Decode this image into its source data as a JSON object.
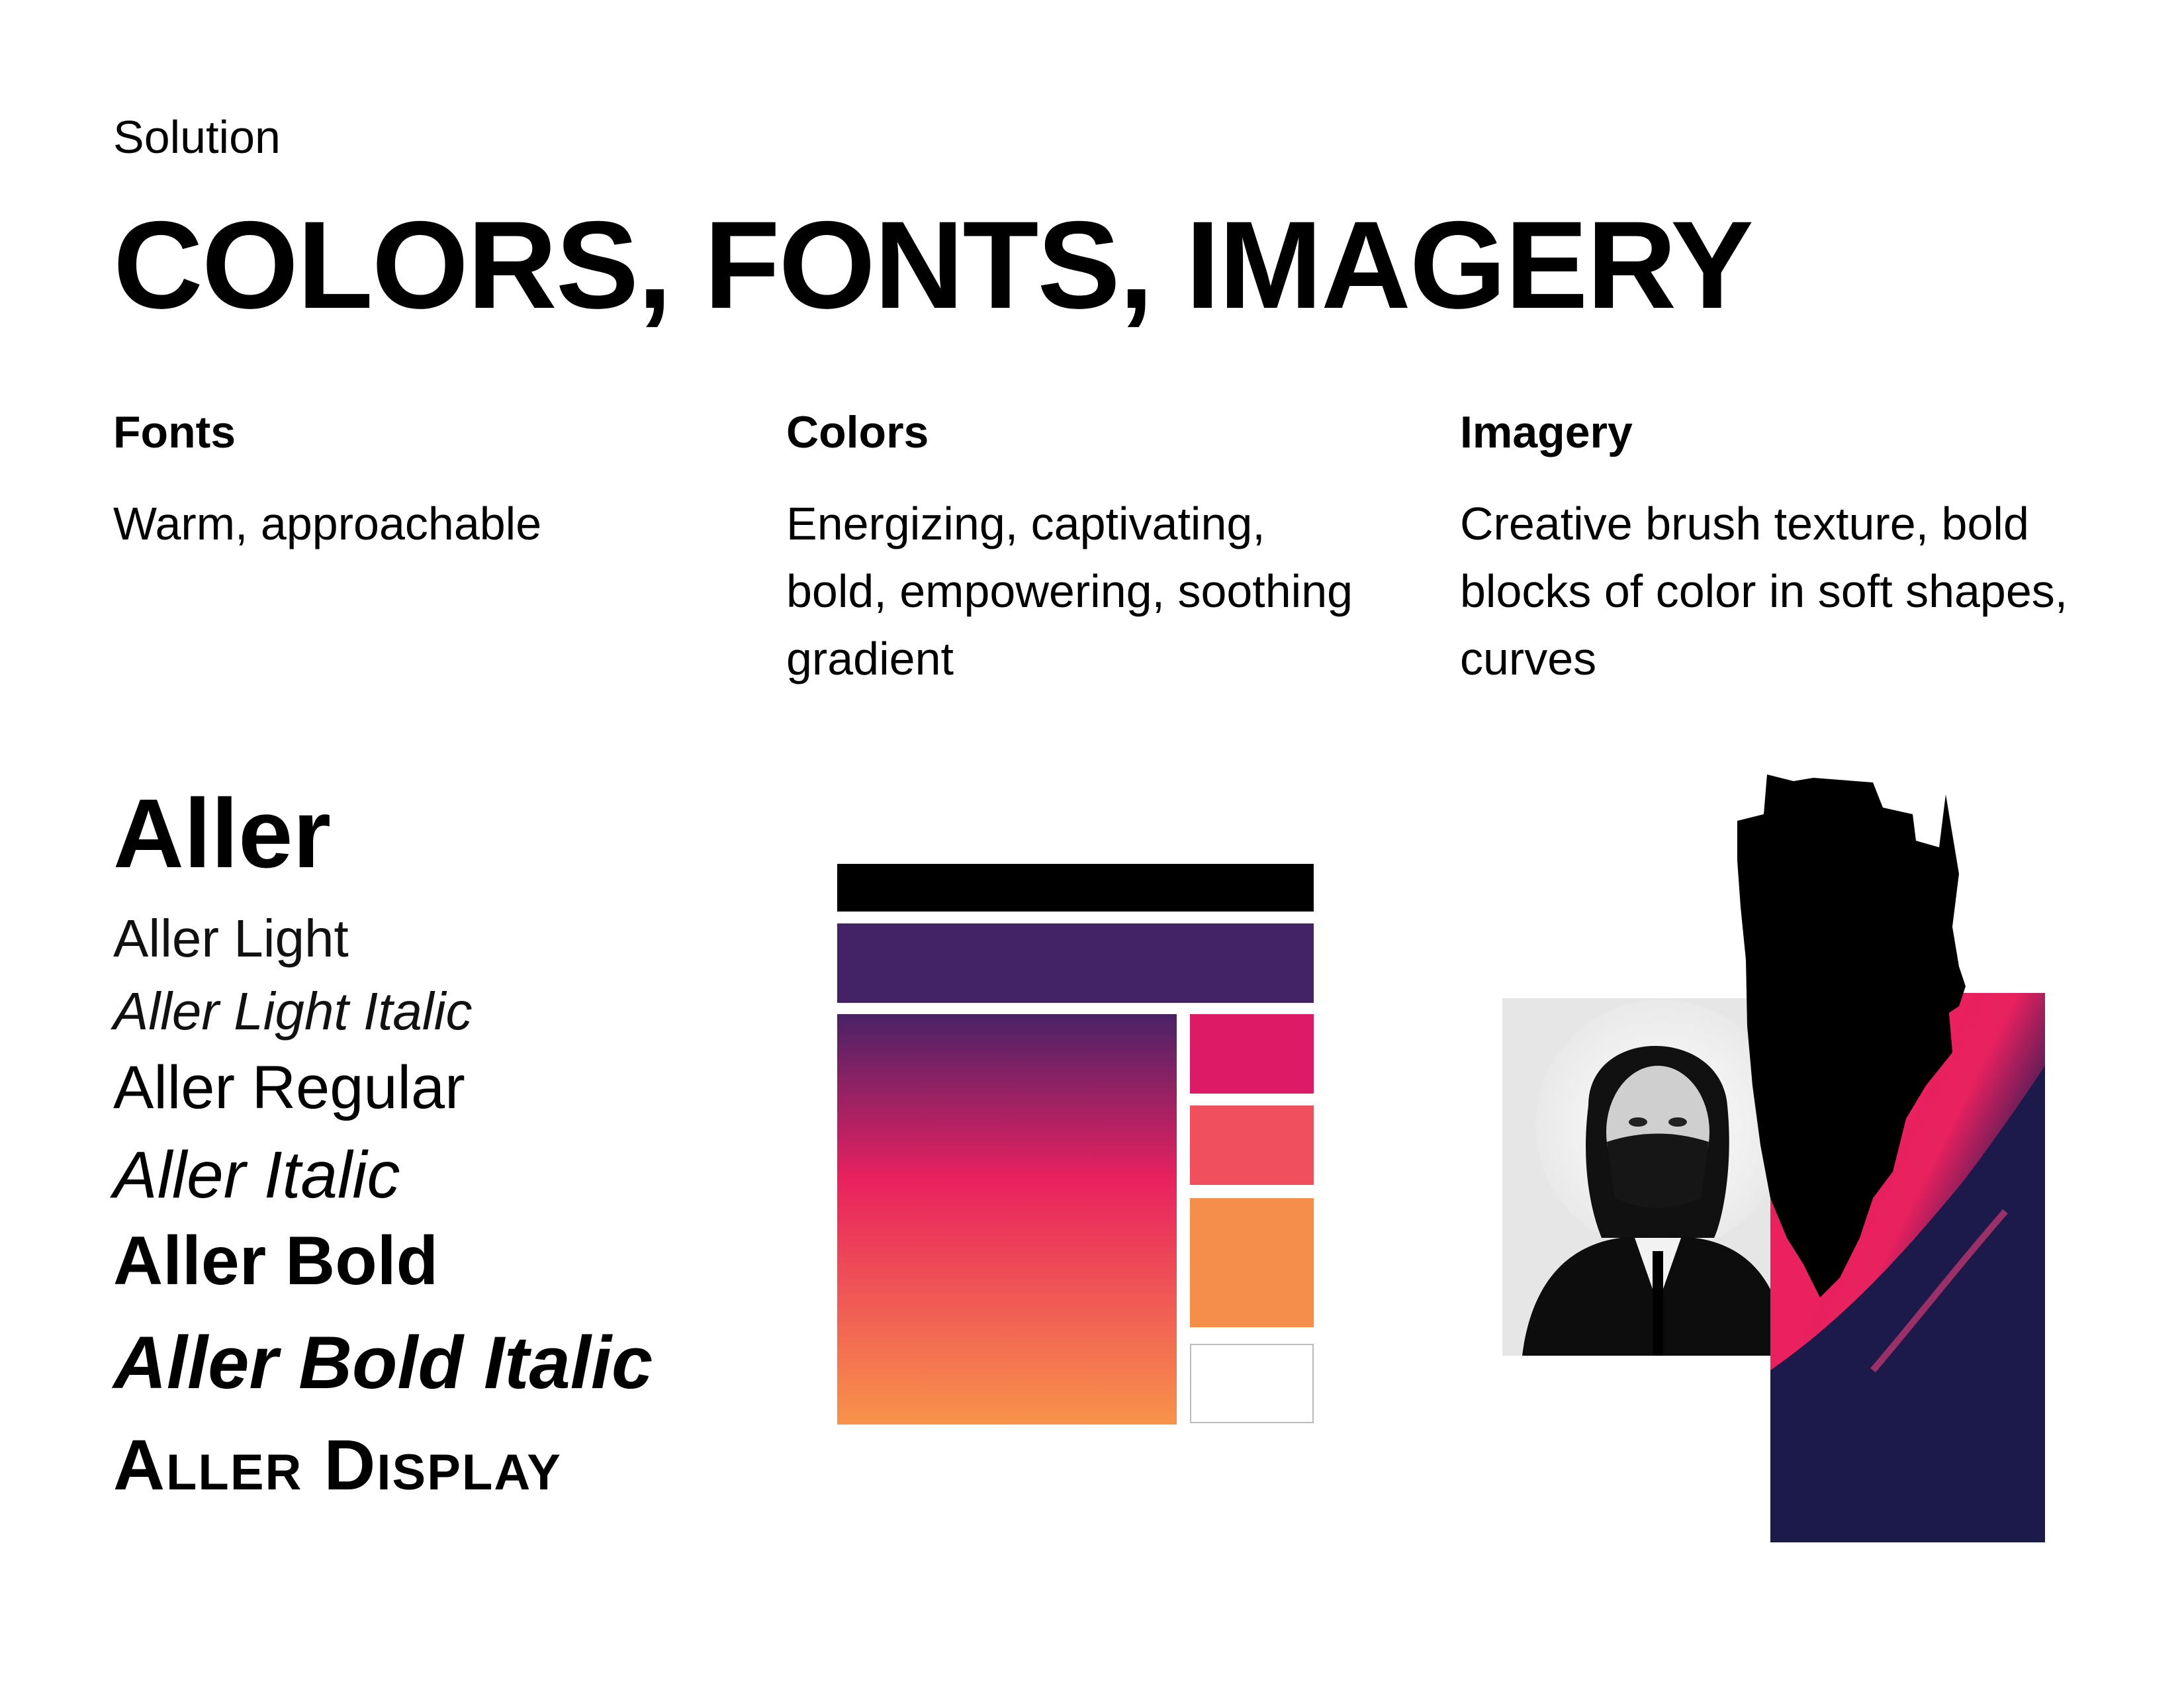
{
  "header": {
    "eyebrow": "Solution",
    "title": "COLORS, FONTS, IMAGERY"
  },
  "columns": {
    "fonts": {
      "heading": "Fonts",
      "description": "Warm, approachable"
    },
    "colors": {
      "heading": "Colors",
      "description": "Energizing, captivating, bold, empowering, soothing gradient"
    },
    "imagery": {
      "heading": "Imagery",
      "description": "Creative brush texture, bold blocks of color in soft shapes, curves"
    }
  },
  "font_samples": {
    "family": "Aller",
    "light": "Aller Light",
    "light_italic": "Aller Light Italic",
    "regular": "Aller Regular",
    "italic": "Aller Italic",
    "bold": "Aller Bold",
    "bold_italic": "Aller Bold Italic",
    "display": "Aller Display"
  },
  "palette": {
    "black": "#000000",
    "purple": "#432266",
    "magenta": "#DD1A66",
    "coral": "#F04F5E",
    "orange": "#F58E4A",
    "white": "#FFFFFF",
    "gradient": [
      "#4A2267",
      "#E8215F",
      "#F8934A"
    ],
    "divider_gradient": [
      "#F58E4A",
      "#E8265E",
      "#5A2A6A"
    ]
  },
  "imagery": {
    "portrait": "portrait-photo",
    "brush": "black-brush-stroke",
    "abstract": "pink-navy-abstract-photo"
  }
}
